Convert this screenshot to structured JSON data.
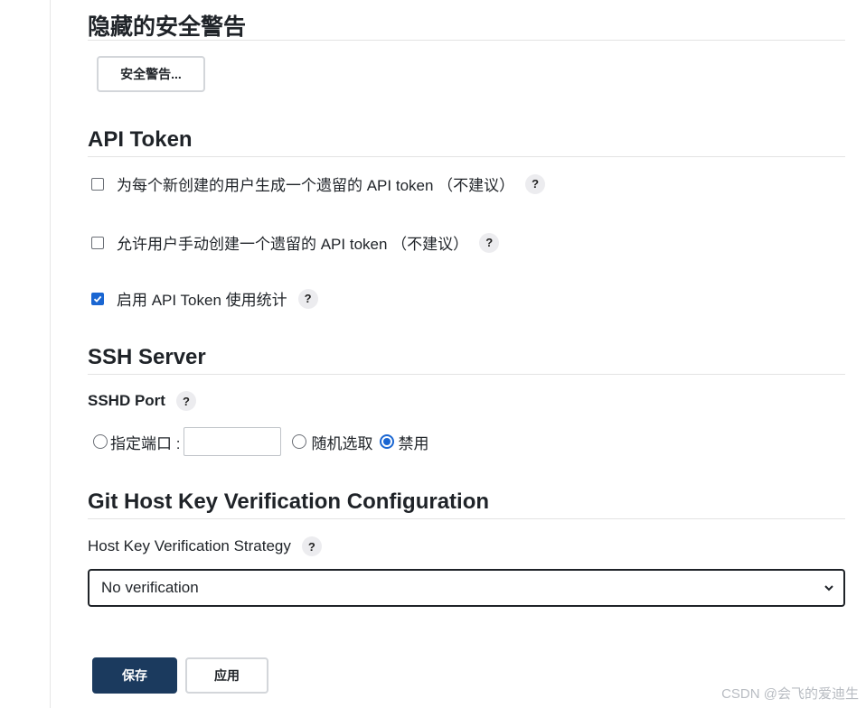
{
  "hidden_warnings": {
    "title": "隐藏的安全警告",
    "button_label": "安全警告..."
  },
  "api_token": {
    "title": "API Token",
    "options": [
      {
        "label": "为每个新创建的用户生成一个遗留的 API token （不建议）",
        "checked": false
      },
      {
        "label": "允许用户手动创建一个遗留的 API token （不建议）",
        "checked": false
      },
      {
        "label": "启用 API Token 使用统计",
        "checked": true
      }
    ]
  },
  "ssh_server": {
    "title": "SSH Server",
    "port_label": "SSHD Port",
    "radio_options": [
      {
        "label": "指定端口 :",
        "checked": false
      },
      {
        "label": "随机选取",
        "checked": false
      },
      {
        "label": "禁用",
        "checked": true
      }
    ],
    "port_value": ""
  },
  "git_host_key": {
    "title": "Git Host Key Verification Configuration",
    "strategy_label": "Host Key Verification Strategy",
    "selected_strategy": "No verification"
  },
  "actions": {
    "save_label": "保存",
    "apply_label": "应用"
  },
  "help_glyph": "?",
  "watermark": "CSDN @会飞的爱迪生",
  "colors": {
    "primary": "#1b3a5e",
    "accent": "#1a66d2"
  }
}
